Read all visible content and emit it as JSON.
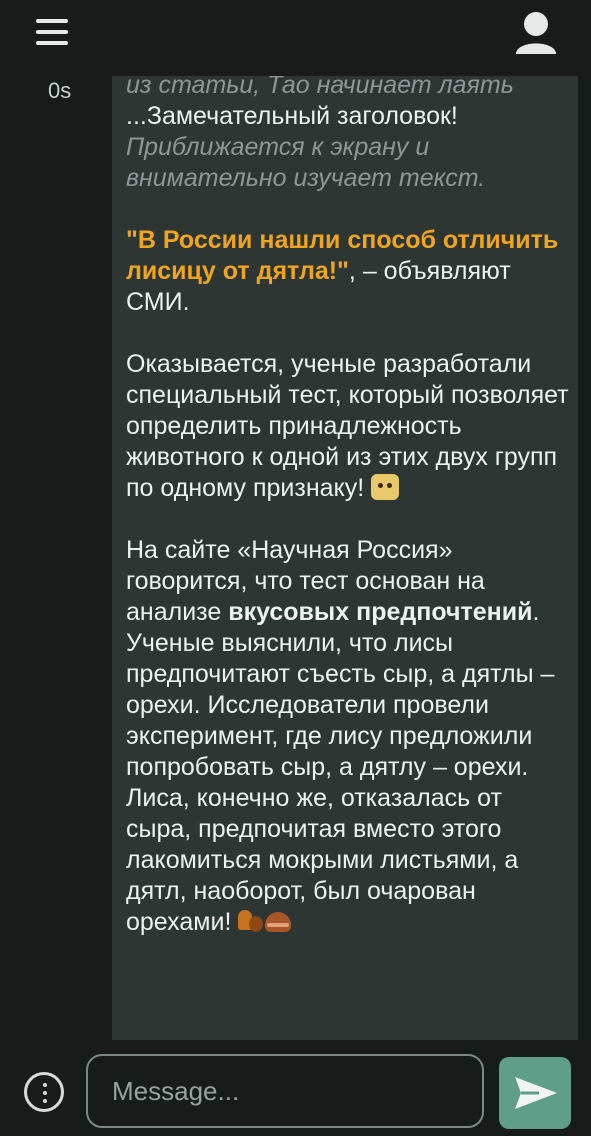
{
  "header": {
    "menu_icon": "hamburger-menu-icon",
    "avatar_icon": "user-avatar-icon"
  },
  "message": {
    "timestamp": "0s",
    "p1": {
      "italic1": "из статьи, Тао начинает лаять",
      "text1": " ...Замечательный заголовок! ",
      "italic2": "Приближается к экрану и внимательно изучает текст."
    },
    "p2": {
      "highlight": "\"В России нашли способ отличить лисицу от дятла!\"",
      "rest": ", – объявляют СМИ."
    },
    "p3": {
      "text": "Оказывается, ученые разработали специальный тест, который позволяет определить принадлежность животного к одной из этих двух групп по одному признаку! ",
      "emoji": "shocked-cat-emoji"
    },
    "p4": {
      "text1": "На сайте «Научная Россия» говорится, что  тест основан на анализе ",
      "bold": "вкусовых предпочтений",
      "text2": ". Ученые выяснили, что лисы предпочитают съесть сыр, а дятлы – орехи. Исследователи провели эксперимент, где лису предложили попробовать сыр, а дятлу – орехи. Лиса, конечно же, отказалась от сыра, предпочитая вместо этого лакомиться мокрыми листьями, а дятл, наоборот, был очарован орехами! ",
      "emoji1": "squirrel-emoji",
      "emoji2": "chestnut-emoji"
    }
  },
  "composer": {
    "placeholder": "Message...",
    "options_icon": "more-options-icon",
    "send_icon": "send-icon"
  },
  "colors": {
    "background": "#171c1b",
    "bubble": "#2d3633",
    "highlight": "#f1a51f",
    "send_button": "#5f9f89"
  }
}
